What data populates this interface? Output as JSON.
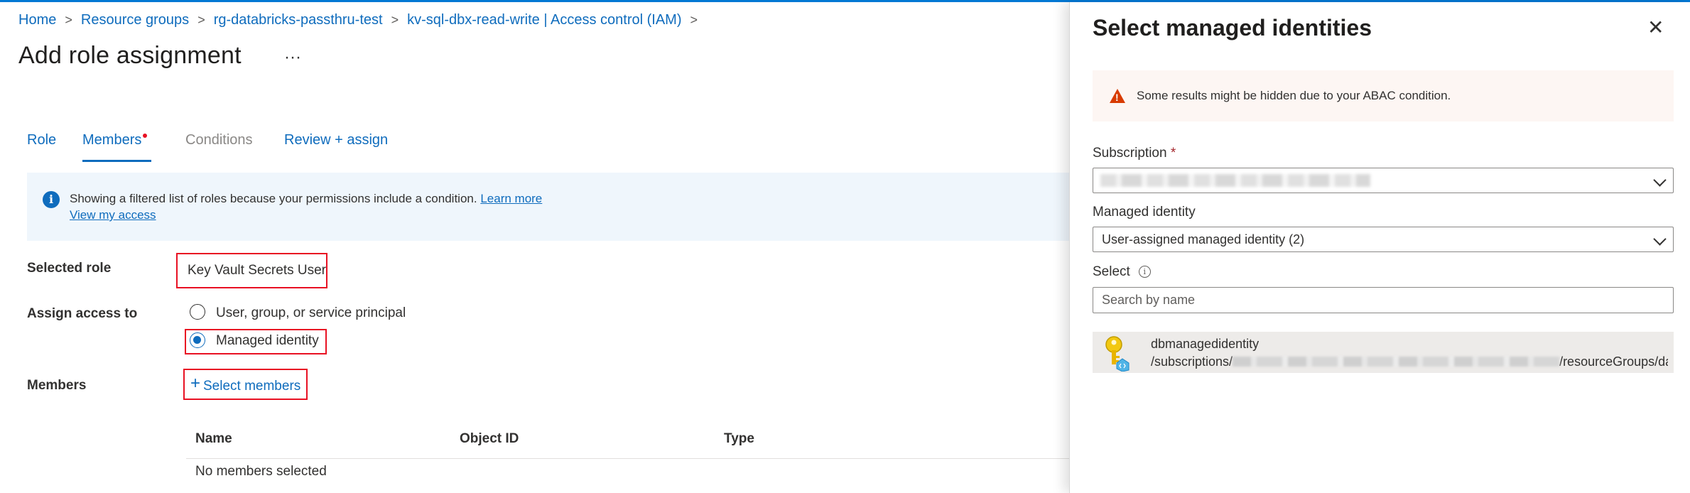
{
  "breadcrumb": [
    "Home",
    "Resource groups",
    "rg-databricks-passthru-test",
    "kv-sql-dbx-read-write | Access control (IAM)"
  ],
  "page": {
    "title": "Add role assignment",
    "more_label": "···"
  },
  "tabs": [
    {
      "label": "Role"
    },
    {
      "label": "Members"
    },
    {
      "label": "Conditions"
    },
    {
      "label": "Review + assign"
    }
  ],
  "info_bar": {
    "text": "Showing a filtered list of roles because your permissions include a condition.",
    "learn_more": "Learn more",
    "view_access": "View my access"
  },
  "form": {
    "selected_role_label": "Selected role",
    "selected_role_value": "Key Vault Secrets User",
    "assign_access_label": "Assign access to",
    "assign_options": [
      {
        "label": "User, group, or service principal",
        "checked": false
      },
      {
        "label": "Managed identity",
        "checked": true
      }
    ],
    "members_label": "Members",
    "select_members": "Select members"
  },
  "members_table": {
    "columns": [
      "Name",
      "Object ID",
      "Type"
    ],
    "empty_text": "No members selected"
  },
  "panel": {
    "title": "Select managed identities",
    "close_label": "✕",
    "warning": "Some results might be hidden due to your ABAC condition.",
    "subscription_label": "Subscription",
    "required_mark": "*",
    "managed_identity_label": "Managed identity",
    "managed_identity_value": "User-assigned managed identity (2)",
    "select_label": "Select",
    "search_placeholder": "Search by name",
    "result": {
      "name": "dbmanagedidentity",
      "path_prefix": "/subscriptions/",
      "path_suffix": "/resourceGroups/databric..."
    }
  },
  "colors": {
    "accent": "#0f6cbd",
    "highlight_box": "#e81123",
    "warning": "#d83b01",
    "info_bg": "#eff6fc"
  },
  "icons": [
    "chevron-right-icon",
    "more-icon",
    "info-icon",
    "warning-icon",
    "close-icon",
    "chevron-down-icon",
    "key-identity-icon",
    "plus-icon"
  ]
}
